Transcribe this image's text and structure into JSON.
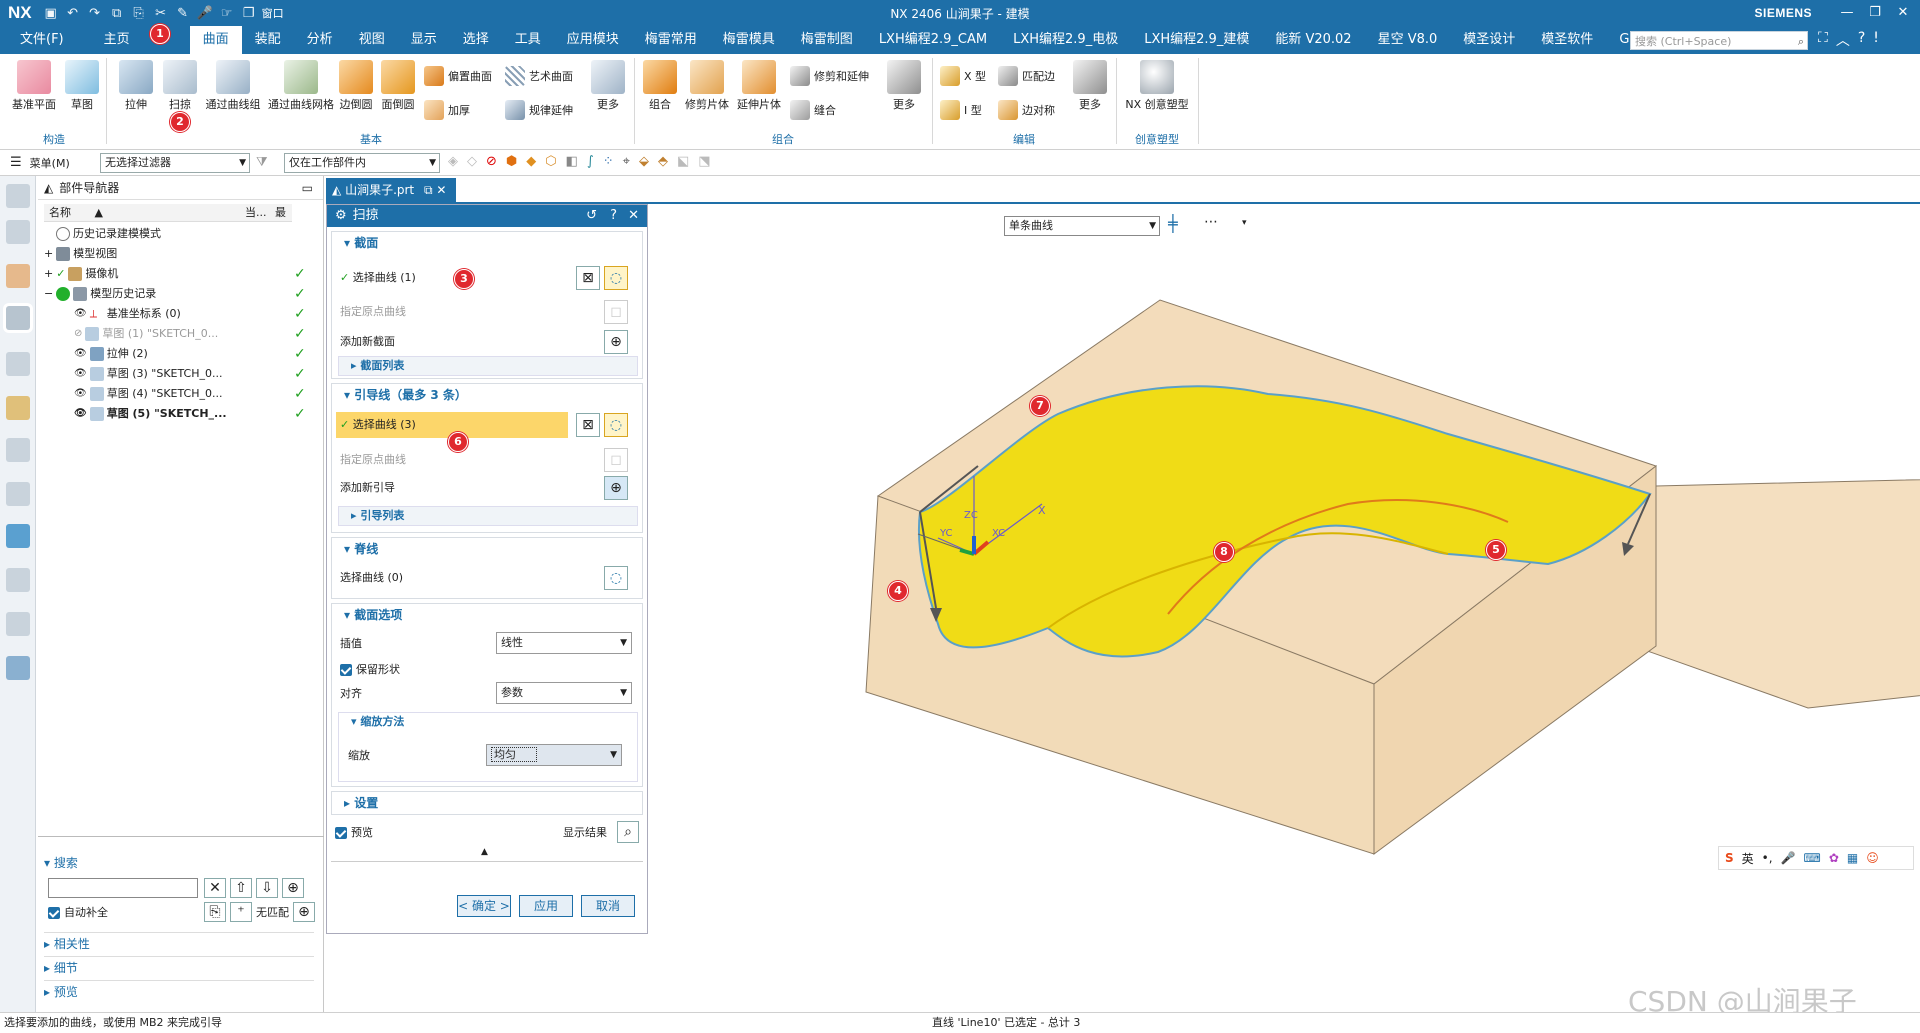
{
  "titlebar": {
    "logo": "NX",
    "title": "NX 2406 山涧果子 - 建模",
    "brand": "SIEMENS",
    "window_menu": "窗口",
    "quick_icons": [
      "save-icon",
      "undo-icon",
      "redo-icon",
      "copy-icon",
      "paste-icon",
      "mic-icon"
    ]
  },
  "menubar": {
    "items": [
      "文件(F)",
      "主页",
      "曲面",
      "装配",
      "分析",
      "视图",
      "显示",
      "选择",
      "工具",
      "应用模块",
      "梅雷常用",
      "梅雷模具",
      "梅雷制图",
      "LXH编程2.9_CAM",
      "LXH编程2.9_电极",
      "LXH编程2.9_建模",
      "能新 V20.02",
      "星空 V8.0",
      "模圣设计",
      "模圣软件",
      "GC工具箱"
    ],
    "active": "曲面",
    "search_placeholder": "搜索 (Ctrl+Space)"
  },
  "ribbon": {
    "construct": {
      "buttons": [
        "基准平面",
        "草图"
      ],
      "group": "构造"
    },
    "basic": {
      "buttons": [
        "拉伸",
        "扫掠",
        "通过曲线组",
        "通过曲线网格",
        "边倒圆",
        "面倒圆"
      ],
      "small": [
        "偏置曲面",
        "加厚",
        "艺术曲面",
        "规律延伸"
      ],
      "more": "更多",
      "group": "基本"
    },
    "combine": {
      "buttons": [
        "组合",
        "修剪片体",
        "延伸片体"
      ],
      "small": [
        "修剪和延伸",
        "缝合"
      ],
      "more": "更多",
      "group": "组合"
    },
    "edit": {
      "small": [
        "X 型",
        "I 型",
        "匹配边",
        "边对称"
      ],
      "more": "更多",
      "group": "编辑"
    },
    "creative": {
      "buttons": [
        "NX 创意塑型"
      ],
      "group": "创意塑型"
    }
  },
  "badges": {
    "b1": "1",
    "b2": "2",
    "b3": "3",
    "b4": "4",
    "b5": "5",
    "b6": "6",
    "b7": "7",
    "b8": "8"
  },
  "toolbar2": {
    "menu_label": "菜单(M)",
    "filter": "无选择过滤器",
    "scope": "仅在工作部件内"
  },
  "navigator": {
    "title": "部件导航器",
    "columns": [
      "名称",
      "当...",
      "最"
    ],
    "rows": [
      {
        "label": "历史记录建模模式",
        "dim": false
      },
      {
        "label": "模型视图",
        "dim": false
      },
      {
        "label": "摄像机",
        "dim": false
      },
      {
        "label": "模型历史记录",
        "dim": false
      },
      {
        "label": "基准坐标系 (0)",
        "dim": false
      },
      {
        "label": "草图 (1) \"SKETCH_0...",
        "dim": true
      },
      {
        "label": "拉伸 (2)",
        "dim": false
      },
      {
        "label": "草图 (3) \"SKETCH_0...",
        "dim": false
      },
      {
        "label": "草图 (4) \"SKETCH_0...",
        "dim": false
      },
      {
        "label": "草图 (5) \"SKETCH_...",
        "dim": false
      }
    ],
    "search_title": "搜索",
    "auto_complete": "自动补全",
    "no_match": "无匹配",
    "panels": [
      "相关性",
      "细节",
      "预览"
    ]
  },
  "doc_tab": {
    "label": "山涧果子.prt"
  },
  "dialog": {
    "title": "扫掠",
    "section": {
      "title": "截面",
      "select_curve": "选择曲线 (1)",
      "origin_curve": "指定原点曲线",
      "add_new": "添加新截面",
      "list": "截面列表"
    },
    "guide": {
      "title": "引导线（最多 3 条）",
      "select_curve": "选择曲线 (3)",
      "origin_curve": "指定原点曲线",
      "add_new": "添加新引导",
      "list": "引导列表"
    },
    "spine": {
      "title": "脊线",
      "select_curve": "选择曲线 (0)"
    },
    "options": {
      "title": "截面选项",
      "interp_label": "插值",
      "interp_value": "线性",
      "keep_shape": "保留形状",
      "align_label": "对齐",
      "align_value": "参数",
      "scale_title": "缩放方法",
      "scale_label": "缩放",
      "scale_value": "均匀"
    },
    "settings": {
      "title": "设置"
    },
    "preview_label": "预览",
    "show_result": "显示结果",
    "ok": "< 确定 >",
    "apply": "应用",
    "cancel": "取消"
  },
  "viewport": {
    "curve_rule": "单条曲线",
    "axes": {
      "x": "X",
      "xc": "XC",
      "yc": "YC",
      "zc": "ZC"
    },
    "ime": "英",
    "watermark": "CSDN @山涧果子"
  },
  "status": {
    "left": "选择要添加的曲线，或使用 MB2 来完成引导",
    "center": "直线 'Line10' 已选定 - 总计 3"
  },
  "colors": {
    "brand_blue": "#1e6fa8",
    "badge_red": "#e0282e",
    "block": "#f2ddbd",
    "surface": "#f0dc16"
  }
}
